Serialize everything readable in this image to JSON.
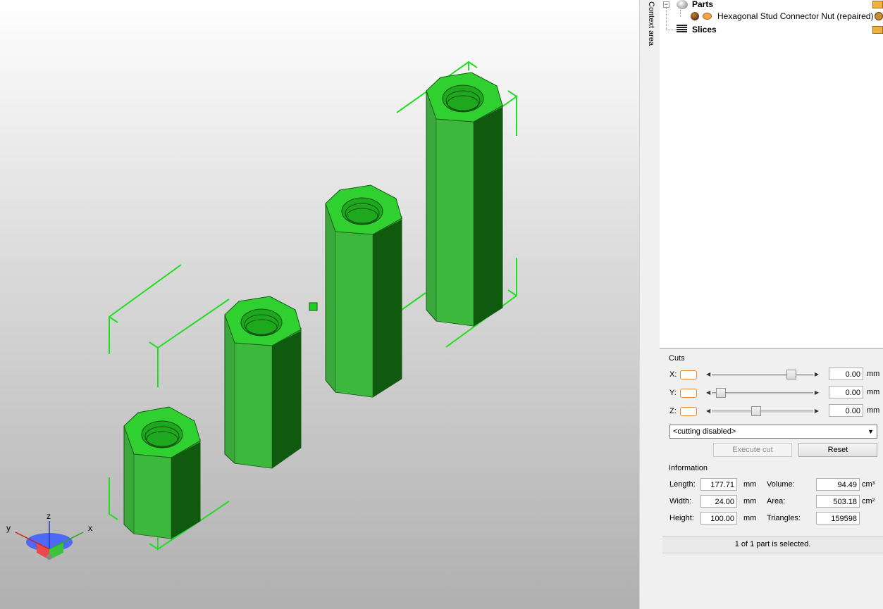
{
  "tree": {
    "parts_label": "Parts",
    "part_name": "Hexagonal Stud Connector Nut (repaired)",
    "slices_label": "Slices"
  },
  "context_tab_label": "Context area",
  "cuts": {
    "title": "Cuts",
    "x_label": "X:",
    "y_label": "Y:",
    "z_label": "Z:",
    "x_value": "0.00",
    "y_value": "0.00",
    "z_value": "0.00",
    "x_slider_fraction": 0.85,
    "y_slider_fraction": 0.0,
    "z_slider_fraction": 0.42,
    "unit": "mm",
    "mode_selected": "<cutting disabled>",
    "execute_label": "Execute cut",
    "reset_label": "Reset"
  },
  "information": {
    "title": "Information",
    "length_label": "Length:",
    "length_value": "177.71",
    "width_label": "Width:",
    "width_value": "24.00",
    "height_label": "Height:",
    "height_value": "100.00",
    "mm_unit": "mm",
    "volume_label": "Volume:",
    "volume_value": "94.49",
    "volume_unit": "cm³",
    "area_label": "Area:",
    "area_value": "503.18",
    "area_unit": "cm²",
    "triangles_label": "Triangles:",
    "triangles_value": "159598"
  },
  "status_text": "1 of 1 part is selected.",
  "axes": {
    "z": "z",
    "y": "y",
    "x": "x"
  },
  "colors": {
    "part_green": "#2db82d",
    "accent_orange": "#e08a3c",
    "bbox_green": "#22dd22"
  }
}
